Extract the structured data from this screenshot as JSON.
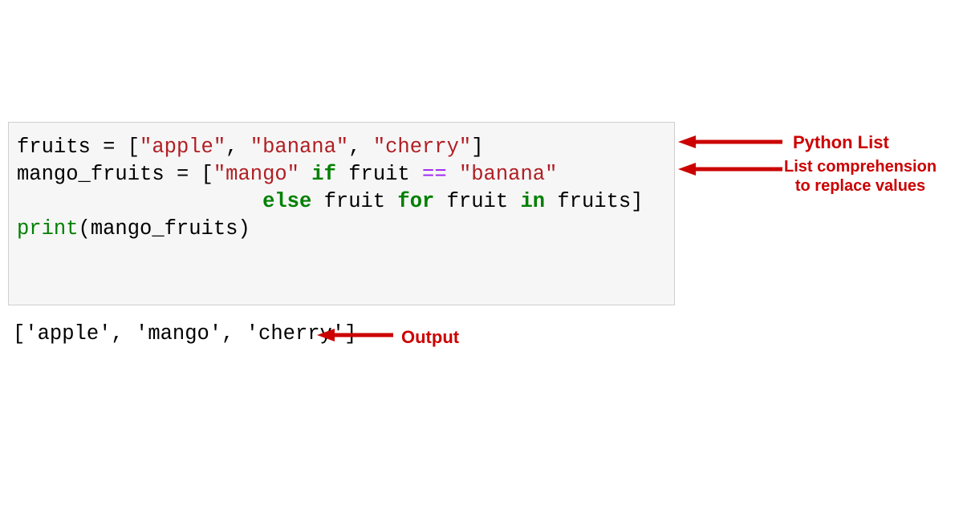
{
  "code": {
    "line1_tokens": {
      "var": "fruits",
      "assign": " = [",
      "s1": "\"apple\"",
      "c1": ", ",
      "s2": "\"banana\"",
      "c2": ", ",
      "s3": "\"cherry\"",
      "end": "]"
    },
    "line2_tokens": {
      "var": "mango_fruits",
      "assign": " = [",
      "s1": "\"mango\"",
      "sp1": " ",
      "kw_if": "if",
      "sp2": " fruit ",
      "op": "==",
      "sp3": " ",
      "s2": "\"banana\"",
      "indent": "                    ",
      "kw_else": "else",
      "mid": " fruit ",
      "kw_for": "for",
      "mid2": " fruit ",
      "kw_in": "in",
      "end": " fruits]"
    },
    "blank": "",
    "line4_tokens": {
      "fn": "print",
      "rest": "(mango_fruits)"
    }
  },
  "output": "['apple', 'mango', 'cherry']",
  "annotations": {
    "python_list": "Python List",
    "list_comp": "List comprehension\nto replace values",
    "output": "Output"
  }
}
